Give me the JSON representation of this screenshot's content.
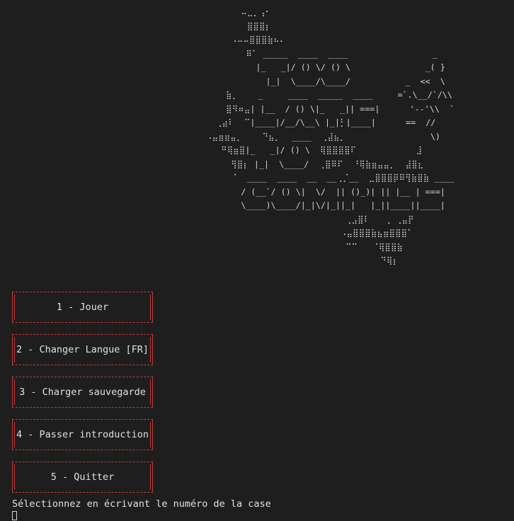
{
  "ascii_art": "        ⠤⣀⡀⢠⠂⠀⠀⠀⠀⠀⠀⠀⠀⠀⠀⠀⠀⠀⠀⠀⠀⠀⠀⠀⠀⠀\n        ⠀⣿⣿⣿⡆⠀⠀⠀⠀⠀⠀⠀⠀⠀⠀⠀⠀⠀⠀⠀⠀⠀⠀⠀⠀\n      ⠠⠤⠤⣿⣿⣿⣷⠦⠄⠀⠀⠀⠀⠀⠀⠀⠀⠀⠀⠀⠀⠀⠀⠀⠀\n         ⠿⠁ _____  ____  ____                 _\n           |_   _|/ () \\/ () \\               _( }\n             |_|  \\____/\\____/           _  <<  \\\n     ⣷⡀    _     ____  _____  ____     =`.\\__/`/\\\\\n     ⣿⠻⠶⣤| |__  / () \\|_   _|| ===|      '--'\\\\  `\n   ⢀⣴⠇  ⠉|____|/__/\\__\\ |_|⡃|____|      ==  //\n ⠠⣤⣶⣶⣤⡀    ⠙⣦⡀⠀ ____  ⢀⣼⣦⡀                 \\)\n    ⠛⢿⣶⣿|_   _|/ () \\  ⢿⣿⣿⣿⣿⠏            ⣸\n      ⢻⣿⡆ |_|  \\____/  ⢀⣿⠿⠏  ⠘⢿⣷⣶⣤⣤⡀  ⣼⣿⣆\n      ⠈  ____  ____  __  __⢀⡈__  ⣀⣿⣿⣿⡿⠿⢻⣷⣿⣷ ____\n        / (__`/ () \\|  \\/  || ()_)| || |__ | ===|\n        \\____)\\____/|_|\\/|_||_|   |_||____||____|\n                             ⢀⣠⣿⠇   ⢀ ⢀⣤⡟\n                            ⠠⣤⣿⣿⣿⣷⣦⣶⣿⣿⣿⠁\n                             ⠉⠉   ⠈⢿⣿⣿⣷\n                                    ⠙⢿⡆",
  "menu": {
    "items": [
      {
        "label": "1 - Jouer"
      },
      {
        "label": "2 - Changer Langue [FR]"
      },
      {
        "label": "3 - Charger sauvegarde"
      },
      {
        "label": "4 - Passer introduction"
      },
      {
        "label": "5 - Quitter"
      }
    ]
  },
  "prompt": {
    "text": "Sélectionnez en écrivant le numéro de la case"
  },
  "colors": {
    "background": "#1e1e1e",
    "text": "#d4d4d4",
    "box_border": "#c23a3a"
  }
}
